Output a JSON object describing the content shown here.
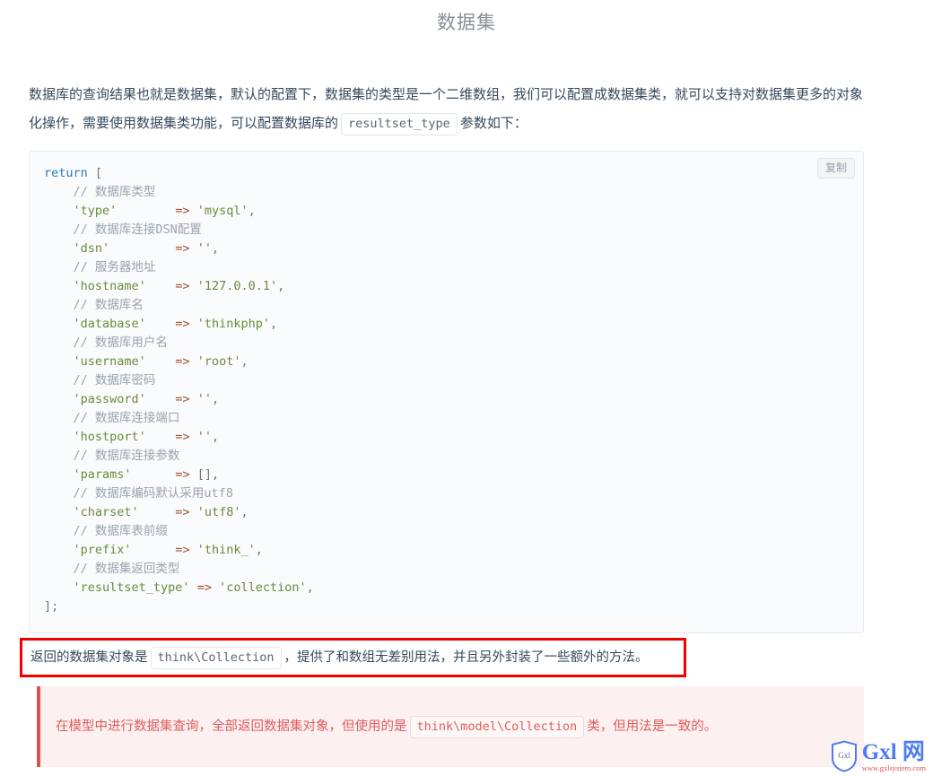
{
  "page": {
    "title": "数据集"
  },
  "intro": {
    "part1": "数据库的查询结果也就是数据集，默认的配置下，数据集的类型是一个二维数组，我们可以配置成数据集类，就可以支持对数据集更多的对象化操作，需要使用数据集类功能，可以配置数据库的",
    "inline_code": "resultset_type",
    "part2": "参数如下："
  },
  "code_block": {
    "copy_label": "复制",
    "language": "php",
    "lines": [
      {
        "tokens": [
          {
            "t": "return",
            "c": "kw"
          },
          {
            "t": " ",
            "c": "pun"
          },
          {
            "t": "[",
            "c": "pun"
          }
        ]
      },
      {
        "tokens": [
          {
            "t": "    ",
            "c": "pun"
          },
          {
            "t": "// 数据库类型",
            "c": "cmt"
          }
        ]
      },
      {
        "tokens": [
          {
            "t": "    ",
            "c": "pun"
          },
          {
            "t": "'type'",
            "c": "str"
          },
          {
            "t": "        ",
            "c": "pun"
          },
          {
            "t": "=>",
            "c": "op"
          },
          {
            "t": " ",
            "c": "pun"
          },
          {
            "t": "'mysql'",
            "c": "str"
          },
          {
            "t": ",",
            "c": "pun"
          }
        ]
      },
      {
        "tokens": [
          {
            "t": "    ",
            "c": "pun"
          },
          {
            "t": "// 数据库连接DSN配置",
            "c": "cmt"
          }
        ]
      },
      {
        "tokens": [
          {
            "t": "    ",
            "c": "pun"
          },
          {
            "t": "'dsn'",
            "c": "str"
          },
          {
            "t": "         ",
            "c": "pun"
          },
          {
            "t": "=>",
            "c": "op"
          },
          {
            "t": " ",
            "c": "pun"
          },
          {
            "t": "''",
            "c": "str"
          },
          {
            "t": ",",
            "c": "pun"
          }
        ]
      },
      {
        "tokens": [
          {
            "t": "    ",
            "c": "pun"
          },
          {
            "t": "// 服务器地址",
            "c": "cmt"
          }
        ]
      },
      {
        "tokens": [
          {
            "t": "    ",
            "c": "pun"
          },
          {
            "t": "'hostname'",
            "c": "str"
          },
          {
            "t": "    ",
            "c": "pun"
          },
          {
            "t": "=>",
            "c": "op"
          },
          {
            "t": " ",
            "c": "pun"
          },
          {
            "t": "'127.0.0.1'",
            "c": "str"
          },
          {
            "t": ",",
            "c": "pun"
          }
        ]
      },
      {
        "tokens": [
          {
            "t": "    ",
            "c": "pun"
          },
          {
            "t": "// 数据库名",
            "c": "cmt"
          }
        ]
      },
      {
        "tokens": [
          {
            "t": "    ",
            "c": "pun"
          },
          {
            "t": "'database'",
            "c": "str"
          },
          {
            "t": "    ",
            "c": "pun"
          },
          {
            "t": "=>",
            "c": "op"
          },
          {
            "t": " ",
            "c": "pun"
          },
          {
            "t": "'thinkphp'",
            "c": "str"
          },
          {
            "t": ",",
            "c": "pun"
          }
        ]
      },
      {
        "tokens": [
          {
            "t": "    ",
            "c": "pun"
          },
          {
            "t": "// 数据库用户名",
            "c": "cmt"
          }
        ]
      },
      {
        "tokens": [
          {
            "t": "    ",
            "c": "pun"
          },
          {
            "t": "'username'",
            "c": "str"
          },
          {
            "t": "    ",
            "c": "pun"
          },
          {
            "t": "=>",
            "c": "op"
          },
          {
            "t": " ",
            "c": "pun"
          },
          {
            "t": "'root'",
            "c": "str"
          },
          {
            "t": ",",
            "c": "pun"
          }
        ]
      },
      {
        "tokens": [
          {
            "t": "    ",
            "c": "pun"
          },
          {
            "t": "// 数据库密码",
            "c": "cmt"
          }
        ]
      },
      {
        "tokens": [
          {
            "t": "    ",
            "c": "pun"
          },
          {
            "t": "'password'",
            "c": "str"
          },
          {
            "t": "    ",
            "c": "pun"
          },
          {
            "t": "=>",
            "c": "op"
          },
          {
            "t": " ",
            "c": "pun"
          },
          {
            "t": "''",
            "c": "str"
          },
          {
            "t": ",",
            "c": "pun"
          }
        ]
      },
      {
        "tokens": [
          {
            "t": "    ",
            "c": "pun"
          },
          {
            "t": "// 数据库连接端口",
            "c": "cmt"
          }
        ]
      },
      {
        "tokens": [
          {
            "t": "    ",
            "c": "pun"
          },
          {
            "t": "'hostport'",
            "c": "str"
          },
          {
            "t": "    ",
            "c": "pun"
          },
          {
            "t": "=>",
            "c": "op"
          },
          {
            "t": " ",
            "c": "pun"
          },
          {
            "t": "''",
            "c": "str"
          },
          {
            "t": ",",
            "c": "pun"
          }
        ]
      },
      {
        "tokens": [
          {
            "t": "    ",
            "c": "pun"
          },
          {
            "t": "// 数据库连接参数",
            "c": "cmt"
          }
        ]
      },
      {
        "tokens": [
          {
            "t": "    ",
            "c": "pun"
          },
          {
            "t": "'params'",
            "c": "str"
          },
          {
            "t": "      ",
            "c": "pun"
          },
          {
            "t": "=>",
            "c": "op"
          },
          {
            "t": " ",
            "c": "pun"
          },
          {
            "t": "[],",
            "c": "pun"
          }
        ]
      },
      {
        "tokens": [
          {
            "t": "    ",
            "c": "pun"
          },
          {
            "t": "// 数据库编码默认采用utf8",
            "c": "cmt"
          }
        ]
      },
      {
        "tokens": [
          {
            "t": "    ",
            "c": "pun"
          },
          {
            "t": "'charset'",
            "c": "str"
          },
          {
            "t": "     ",
            "c": "pun"
          },
          {
            "t": "=>",
            "c": "op"
          },
          {
            "t": " ",
            "c": "pun"
          },
          {
            "t": "'utf8'",
            "c": "str"
          },
          {
            "t": ",",
            "c": "pun"
          }
        ]
      },
      {
        "tokens": [
          {
            "t": "    ",
            "c": "pun"
          },
          {
            "t": "// 数据库表前缀",
            "c": "cmt"
          }
        ]
      },
      {
        "tokens": [
          {
            "t": "    ",
            "c": "pun"
          },
          {
            "t": "'prefix'",
            "c": "str"
          },
          {
            "t": "      ",
            "c": "pun"
          },
          {
            "t": "=>",
            "c": "op"
          },
          {
            "t": " ",
            "c": "pun"
          },
          {
            "t": "'think_'",
            "c": "str"
          },
          {
            "t": ",",
            "c": "pun"
          }
        ]
      },
      {
        "tokens": [
          {
            "t": "    ",
            "c": "pun"
          },
          {
            "t": "// 数据集返回类型",
            "c": "cmt"
          }
        ]
      },
      {
        "tokens": [
          {
            "t": "    ",
            "c": "pun"
          },
          {
            "t": "'resultset_type'",
            "c": "str"
          },
          {
            "t": " ",
            "c": "pun"
          },
          {
            "t": "=>",
            "c": "op"
          },
          {
            "t": " ",
            "c": "pun"
          },
          {
            "t": "'collection'",
            "c": "str"
          },
          {
            "t": ",",
            "c": "pun"
          }
        ]
      },
      {
        "tokens": [
          {
            "t": "];",
            "c": "pun"
          }
        ]
      }
    ]
  },
  "highlight_box": {
    "part1": "返回的数据集对象是",
    "inline_code": "think\\Collection",
    "part2": "，提供了和数组无差别用法，并且另外封装了一些额外的方法。",
    "border_color": "#f00000"
  },
  "alert": {
    "part1": "在模型中进行数据集查询，全部返回数据集对象，但使用的是",
    "inline_code": "think\\model\\Collection",
    "part2": "类，但用法是一致的。",
    "accent_color": "#d9534f",
    "background_color": "#fcf0f0"
  },
  "watermark": {
    "shield_label": "Gxl",
    "brand": "Gxl 网",
    "url": "www.gxlsystem.com",
    "brand_color": "#4d7cf3",
    "url_color": "#d9534f"
  }
}
